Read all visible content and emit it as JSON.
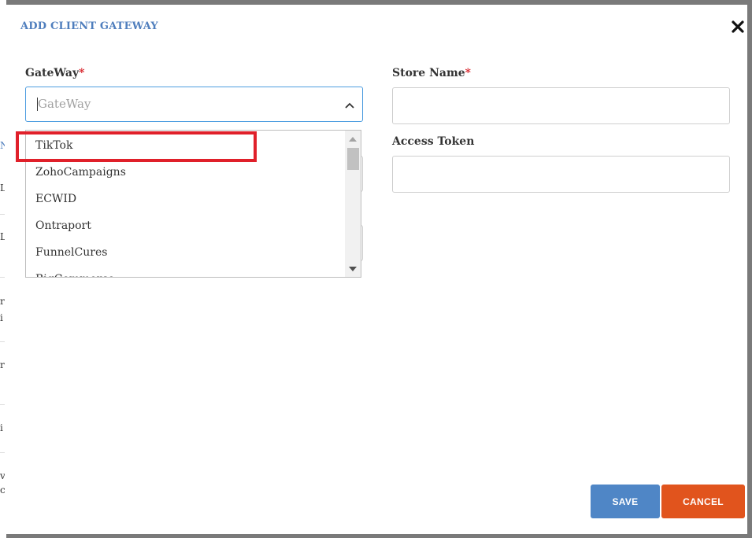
{
  "modal": {
    "title": "ADD CLIENT GATEWAY"
  },
  "gateway": {
    "label": "GateWay",
    "required_mark": "*",
    "placeholder": "GateWay"
  },
  "store_name": {
    "label": "Store Name",
    "required_mark": "*",
    "value": ""
  },
  "access_token": {
    "label": "Access Token",
    "value": ""
  },
  "dropdown": {
    "options": [
      "TikTok",
      "ZohoCampaigns",
      "ECWID",
      "Ontraport",
      "FunnelCures",
      "BigCommerce"
    ],
    "highlighted": "TikTok"
  },
  "buttons": {
    "save": "SAVE",
    "cancel": "CANCEL"
  },
  "background_page": {
    "marks": [
      "N",
      "L",
      "L",
      "r",
      "i",
      "r",
      "i",
      "v",
      "c"
    ]
  },
  "colors": {
    "title": "#4f7ebd",
    "required": "#d8232a",
    "focus_border": "#4d9de0",
    "highlight": "#e0202a",
    "save_button": "#4f86c6",
    "cancel_button": "#e1541d"
  },
  "icons": {
    "close": "close-icon",
    "chevron": "chevron-up-icon"
  }
}
